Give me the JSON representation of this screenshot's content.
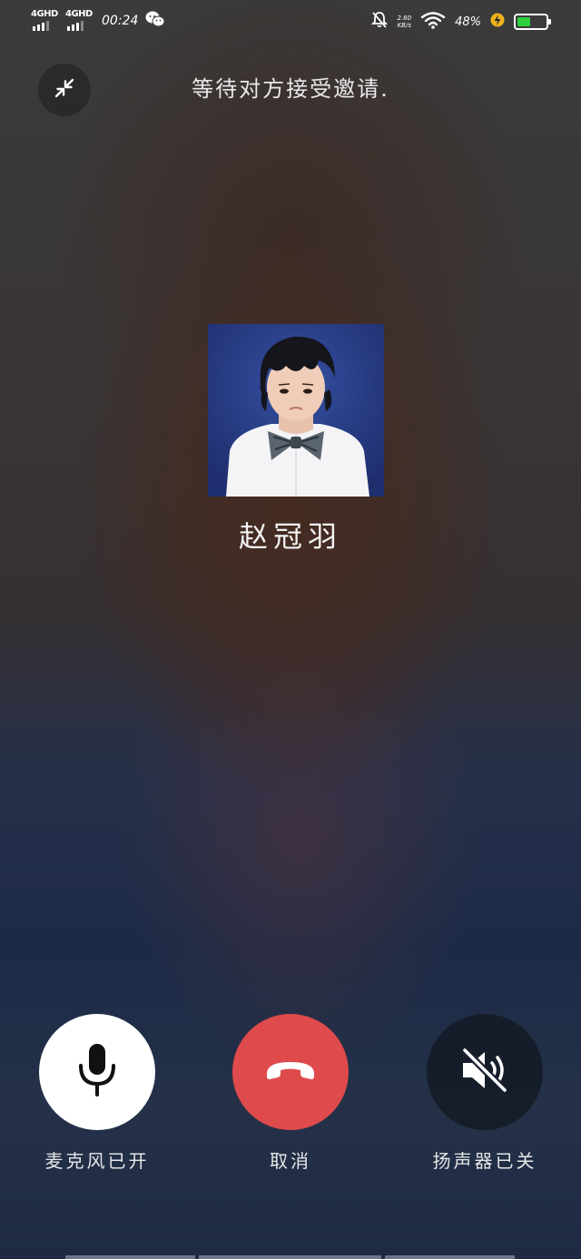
{
  "status_bar": {
    "sim1_label": "4GHD",
    "sim2_label": "4GHD",
    "time": "00:24",
    "net_speed_value": "2.60",
    "net_speed_unit": "KB/s",
    "battery_percent_text": "48%",
    "battery_level": 0.48,
    "battery_color": "#2fcf3e",
    "icons": [
      "signal-icon",
      "wechat-icon",
      "bell-off-icon",
      "wifi-icon",
      "charging-icon",
      "battery-icon"
    ]
  },
  "call": {
    "status_text": "等待对方接受邀请.",
    "contact_name": "赵冠羽"
  },
  "controls": {
    "mic_label": "麦克风已开",
    "cancel_label": "取消",
    "speaker_label": "扬声器已关",
    "cancel_color": "#df4a4c"
  }
}
